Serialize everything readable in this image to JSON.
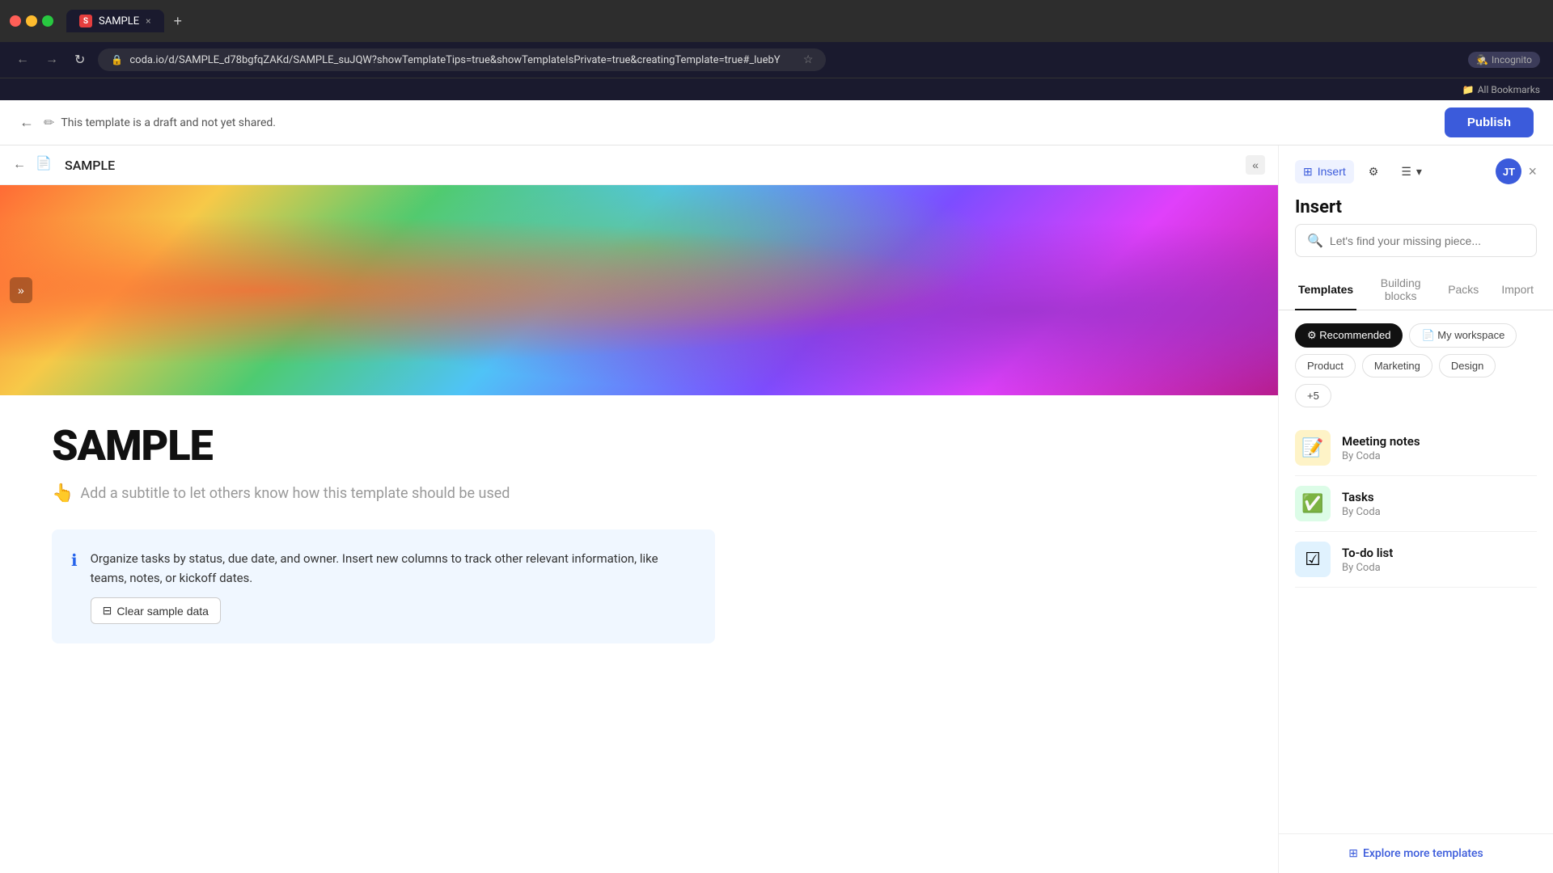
{
  "browser": {
    "tab_favicon": "S",
    "tab_title": "SAMPLE",
    "tab_close": "×",
    "tab_new": "+",
    "url": "coda.io/d/SAMPLE_d78bgfqZAKd/SAMPLE_suJQW?showTemplateTips=true&showTemplateIsPrivate=true&creatingTemplate=true#_luebY",
    "nav_back": "←",
    "nav_forward": "→",
    "nav_reload": "↻",
    "incognito_label": "Incognito",
    "bookmarks_label": "All Bookmarks"
  },
  "app_header": {
    "back": "←",
    "draft_icon": "✏",
    "draft_notice": "This template is a draft and not yet shared.",
    "publish_label": "Publish"
  },
  "doc": {
    "back": "←",
    "title": "SAMPLE",
    "collapse": "«",
    "main_title": "SAMPLE",
    "subtitle_placeholder": "Add a subtitle to let others know how this template should be used",
    "subtitle_icon": "👆",
    "info_text": "Organize tasks by status, due date, and owner. Insert new columns to track other relevant information, like teams, notes, or kickoff dates.",
    "clear_btn_label": "Clear sample data",
    "clear_btn_icon": "⊟"
  },
  "panel": {
    "close_icon": "×",
    "insert_icon": "⊞",
    "insert_label": "Insert",
    "gear_icon": "⚙",
    "comment_icon": "☰",
    "chevron_icon": "▾",
    "avatar_label": "JT",
    "title": "Insert",
    "search_placeholder": "Let's find your missing piece...",
    "tabs": [
      {
        "id": "templates",
        "label": "Templates",
        "active": true
      },
      {
        "id": "building-blocks",
        "label": "Building blocks",
        "active": false
      },
      {
        "id": "packs",
        "label": "Packs",
        "active": false
      },
      {
        "id": "import",
        "label": "Import",
        "active": false
      }
    ],
    "filters": [
      {
        "id": "recommended",
        "label": "Recommended",
        "icon": "⚙",
        "active": true
      },
      {
        "id": "my-workspace",
        "label": "My workspace",
        "icon": "📄",
        "active": false
      }
    ],
    "sub_filters": [
      {
        "id": "product",
        "label": "Product"
      },
      {
        "id": "marketing",
        "label": "Marketing"
      },
      {
        "id": "design",
        "label": "Design"
      },
      {
        "id": "more",
        "label": "+5"
      }
    ],
    "templates": [
      {
        "id": "meeting-notes",
        "name": "Meeting notes",
        "author": "By Coda",
        "icon": "📝",
        "icon_style": "yellow"
      },
      {
        "id": "tasks",
        "name": "Tasks",
        "author": "By Coda",
        "icon": "✅",
        "icon_style": "green"
      },
      {
        "id": "todo-list",
        "name": "To-do list",
        "author": "By Coda",
        "icon": "☑",
        "icon_style": "blue-stripe"
      }
    ],
    "explore_link": "Explore more templates",
    "explore_icon": "⊞"
  }
}
